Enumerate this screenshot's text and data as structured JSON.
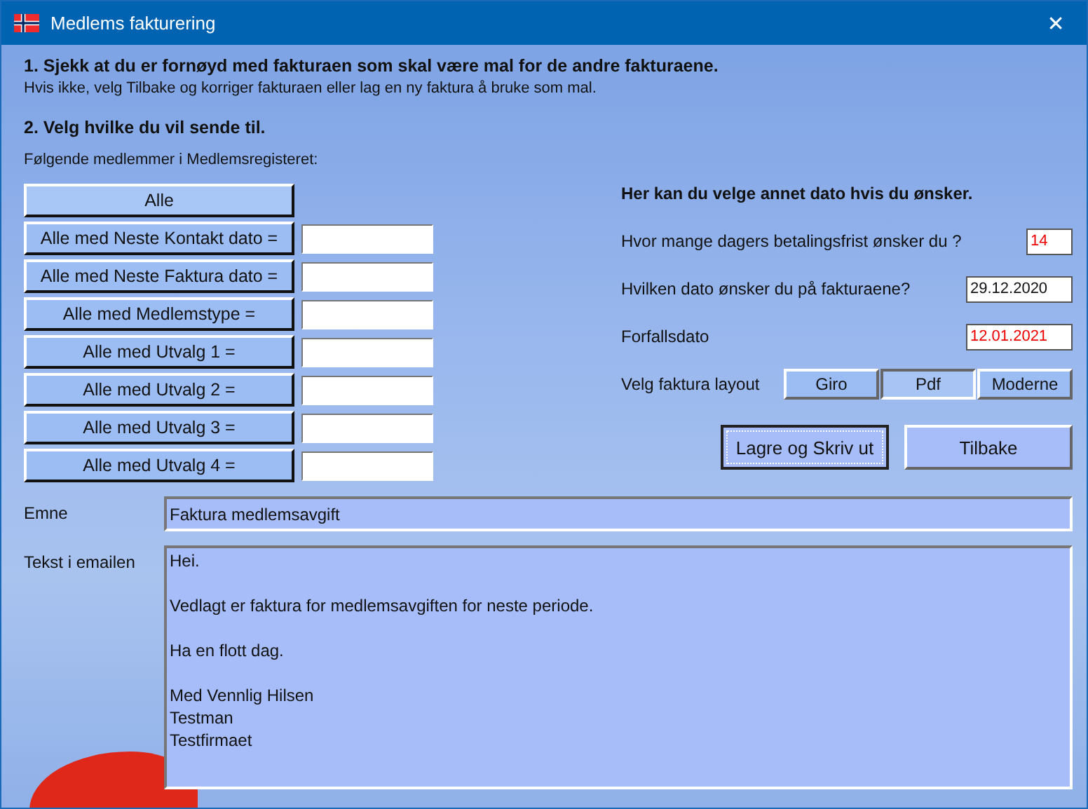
{
  "window": {
    "title": "Medlems fakturering",
    "close": "✕"
  },
  "step1": {
    "heading": "1. Sjekk at du er fornøyd med fakturaen som skal være mal for de andre fakturaene.",
    "hint": "Hvis ikke, velg Tilbake og korriger fakturaen eller lag en ny faktura å bruke som mal."
  },
  "step2": {
    "heading": "2. Velg hvilke du vil sende til.",
    "subtitle": "Følgende medlemmer i Medlemsregisteret:"
  },
  "filters": [
    {
      "label": "Alle",
      "kind": "button"
    },
    {
      "label": "Alle med Neste Kontakt dato =",
      "kind": "input"
    },
    {
      "label": "Alle med Neste Faktura dato =",
      "kind": "input"
    },
    {
      "label": "Alle med Medlemstype =",
      "kind": "input"
    },
    {
      "label": "Alle med Utvalg 1 =",
      "kind": "input"
    },
    {
      "label": "Alle med Utvalg 2 =",
      "kind": "input"
    },
    {
      "label": "Alle med Utvalg 3 =",
      "kind": "input"
    },
    {
      "label": "Alle med Utvalg 4 =",
      "kind": "input"
    }
  ],
  "dates": {
    "heading": "Her kan du velge annet dato hvis du ønsker.",
    "fields": [
      {
        "label": "Hvor mange dagers betalingsfrist ønsker du ?",
        "value": "14",
        "warning": true,
        "kind": "number"
      },
      {
        "label": "Hvilken dato ønsker du på fakturaene?",
        "value": "29.12.2020",
        "warning": false,
        "kind": "date"
      },
      {
        "label": "Forfallsdato",
        "value": "12.01.2021",
        "warning": true,
        "kind": "date"
      }
    ]
  },
  "layout": {
    "label": "Velg faktura layout",
    "options": [
      {
        "label": "Giro",
        "selected": false
      },
      {
        "label": "Pdf",
        "selected": true
      },
      {
        "label": "Moderne",
        "selected": false
      }
    ]
  },
  "actions": [
    {
      "label": "Lagre og Skriv ut",
      "focused": true
    },
    {
      "label": "Tilbake",
      "focused": false
    }
  ],
  "email": {
    "subject_label": "Emne",
    "subject": "Faktura medlemsavgift",
    "body_label": "Tekst i emailen",
    "body": "Hei.\n\nVedlagt er faktura for medlemsavgiften for neste periode.\n\nHa en flott dag.\n\nMed Vennlig Hilsen\nTestman\nTestfirmaet"
  }
}
